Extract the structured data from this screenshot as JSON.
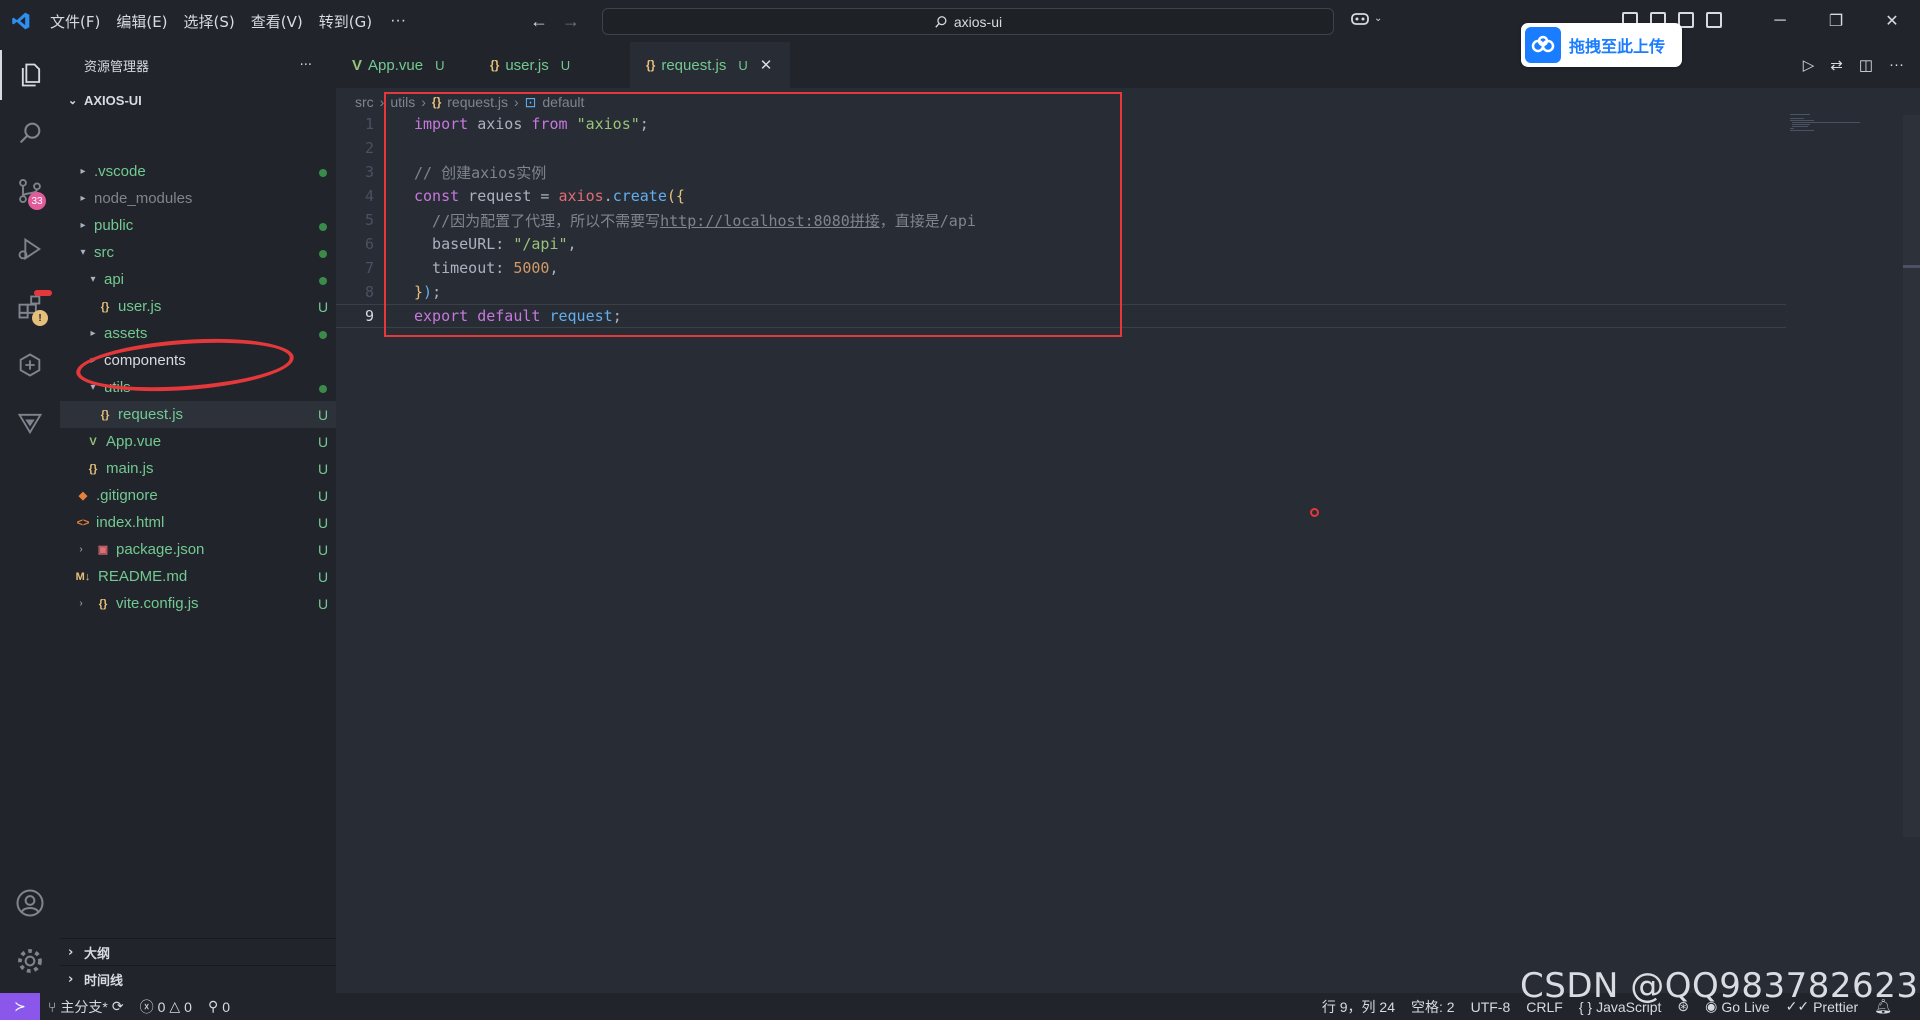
{
  "titlebar": {
    "menu": [
      "文件(F)",
      "编辑(E)",
      "选择(S)",
      "查看(V)",
      "转到(G)"
    ],
    "more": "···",
    "search_text": "axios-ui"
  },
  "baidu_popup": {
    "label": "拖拽至此上传"
  },
  "activity": {
    "scm_badge": "33"
  },
  "explorer": {
    "header": "资源管理器",
    "more": "···",
    "root": "AXIOS-UI",
    "items": [
      {
        "label": ".vscode",
        "status": "dot"
      },
      {
        "label": "node_modules",
        "status": ""
      },
      {
        "label": "public",
        "status": "dot"
      },
      {
        "label": "src",
        "status": "dot"
      },
      {
        "label": "api",
        "status": "dot"
      },
      {
        "label": "user.js",
        "status": "U"
      },
      {
        "label": "assets",
        "status": "dot"
      },
      {
        "label": "components",
        "status": ""
      },
      {
        "label": "utils",
        "status": "dot"
      },
      {
        "label": "request.js",
        "status": "U"
      },
      {
        "label": "App.vue",
        "status": "U"
      },
      {
        "label": "main.js",
        "status": "U"
      },
      {
        "label": ".gitignore",
        "status": "U"
      },
      {
        "label": "index.html",
        "status": "U"
      },
      {
        "label": "package.json",
        "status": "U"
      },
      {
        "label": "README.md",
        "status": "U"
      },
      {
        "label": "vite.config.js",
        "status": "U"
      }
    ],
    "outline": "大纲",
    "timeline": "时间线"
  },
  "tabs": [
    {
      "label": "App.vue",
      "status": "U"
    },
    {
      "label": "user.js",
      "status": "U"
    },
    {
      "label": "request.js",
      "status": "U"
    }
  ],
  "breadcrumb": [
    "src",
    "utils",
    "request.js",
    "default"
  ],
  "editor": {
    "lines": [
      {
        "n": "1",
        "t": [
          [
            "kw",
            "import"
          ],
          [
            "plain",
            " axios "
          ],
          [
            "kw",
            "from"
          ],
          [
            "plain",
            " "
          ],
          [
            "str",
            "\"axios\""
          ],
          [
            "plain",
            ";"
          ]
        ]
      },
      {
        "n": "2",
        "t": []
      },
      {
        "n": "3",
        "t": [
          [
            "cm",
            "// 创建axios实例"
          ]
        ]
      },
      {
        "n": "4",
        "t": [
          [
            "kw",
            "const"
          ],
          [
            "plain",
            " request = "
          ],
          [
            "prop",
            "axios"
          ],
          [
            "plain",
            "."
          ],
          [
            "fn",
            "create"
          ],
          [
            "var",
            "({"
          ]
        ]
      },
      {
        "n": "5",
        "t": [
          [
            "cm",
            "  //因为配置了代理，所以不需要写"
          ],
          [
            "cm link",
            "http://localhost:8080拼接"
          ],
          [
            "cm",
            "，直接是/api"
          ]
        ]
      },
      {
        "n": "6",
        "t": [
          [
            "plain",
            "  baseURL: "
          ],
          [
            "str",
            "\"/api\""
          ],
          [
            "plain",
            ","
          ]
        ]
      },
      {
        "n": "7",
        "t": [
          [
            "plain",
            "  timeout: "
          ],
          [
            "num",
            "5000"
          ],
          [
            "plain",
            ","
          ]
        ]
      },
      {
        "n": "8",
        "t": [
          [
            "var",
            "}"
          ],
          [
            "fn",
            ")"
          ],
          [
            "plain",
            ";"
          ]
        ]
      },
      {
        "n": "9",
        "t": [
          [
            "kw",
            "export"
          ],
          [
            "plain",
            " "
          ],
          [
            "kw",
            "default"
          ],
          [
            "plain",
            " "
          ],
          [
            "fn",
            "request"
          ],
          [
            "plain",
            ";"
          ]
        ]
      }
    ]
  },
  "statusbar": {
    "branch": "主分支*",
    "errors": "0",
    "warnings": "0",
    "ports": "0",
    "position": "行 9，列 24",
    "spaces": "空格: 2",
    "encoding": "UTF-8",
    "eol": "CRLF",
    "language": "JavaScript",
    "golive": "Go Live",
    "prettier": "Prettier"
  },
  "watermark": "CSDN @QQ983782623",
  "colors": {
    "accent": "#8a57ea",
    "annotation_red": "#e5383b",
    "untracked_green": "#73c991"
  }
}
